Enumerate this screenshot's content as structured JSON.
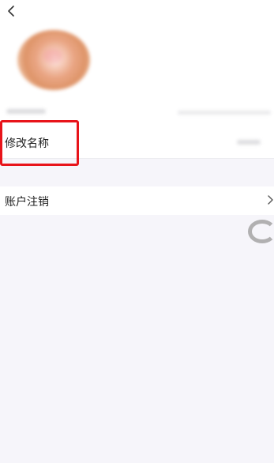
{
  "header": {
    "back_icon": "chevron-left-icon"
  },
  "profile": {
    "avatar_desc": "blurred-avatar"
  },
  "settings": {
    "rename_label": "修改名称",
    "cancel_account_label": "账户注销",
    "chevron_icon": "chevron-right-icon"
  },
  "overlay": {
    "loading_icon": "loading-spinner-icon",
    "highlight_color": "#e8141a"
  }
}
